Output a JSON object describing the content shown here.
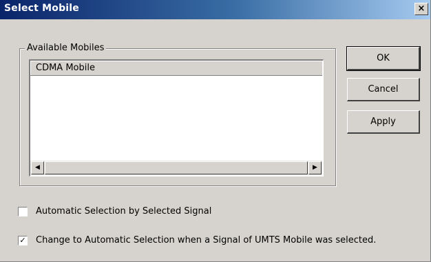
{
  "window": {
    "title": "Select Mobile",
    "close_glyph": "×"
  },
  "groupbox": {
    "label": "Available Mobiles",
    "list_header": "CDMA Mobile",
    "items": []
  },
  "buttons": {
    "ok": "OK",
    "cancel": "Cancel",
    "apply": "Apply"
  },
  "options": {
    "auto_selection": {
      "label": "Automatic Selection by Selected Signal",
      "checked": false
    },
    "change_auto": {
      "label": "Change to Automatic Selection when a Signal of UMTS Mobile was selected.",
      "checked": true,
      "check_glyph": "✓"
    }
  },
  "icons": {
    "scroll_left": "◀",
    "scroll_right": "▶"
  },
  "colors": {
    "dialog_bg": "#d6d3ce",
    "title_start": "#0a246a",
    "title_end": "#a6caf0"
  }
}
